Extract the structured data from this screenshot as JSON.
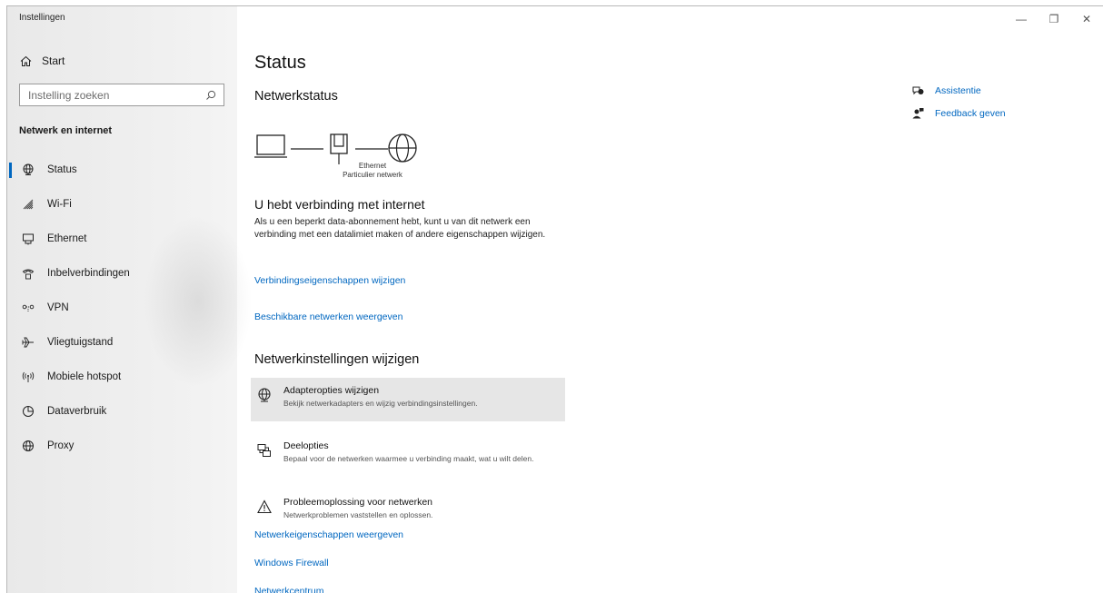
{
  "app": {
    "title": "Instellingen"
  },
  "window_controls": {
    "minimize": "—",
    "maximize": "❐",
    "close": "✕"
  },
  "sidebar": {
    "home_label": "Start",
    "search_placeholder": "Instelling zoeken",
    "section_title": "Netwerk en internet",
    "items": [
      {
        "label": "Status",
        "icon": "globe-network-icon",
        "active": true
      },
      {
        "label": "Wi-Fi",
        "icon": "wifi-icon"
      },
      {
        "label": "Ethernet",
        "icon": "ethernet-icon"
      },
      {
        "label": "Inbelverbindingen",
        "icon": "dialup-icon"
      },
      {
        "label": "VPN",
        "icon": "vpn-icon"
      },
      {
        "label": "Vliegtuigstand",
        "icon": "airplane-icon"
      },
      {
        "label": "Mobiele hotspot",
        "icon": "hotspot-icon"
      },
      {
        "label": "Dataverbruik",
        "icon": "data-usage-icon"
      },
      {
        "label": "Proxy",
        "icon": "globe-icon"
      }
    ]
  },
  "main": {
    "title": "Status",
    "network_status_heading": "Netwerkstatus",
    "adapter_name": "Ethernet",
    "network_profile": "Particulier netwerk",
    "connection_title": "U hebt verbinding met internet",
    "connection_description": "Als u een beperkt data-abonnement hebt, kunt u van dit netwerk een verbinding met een datalimiet maken of andere eigenschappen wijzigen.",
    "link_connection_properties": "Verbindingseigenschappen wijzigen",
    "link_available_networks": "Beschikbare netwerken weergeven",
    "change_settings_heading": "Netwerkinstellingen wijzigen",
    "options": [
      {
        "title": "Adapteropties wijzigen",
        "desc": "Bekijk netwerkadapters en wijzig verbindingsinstellingen.",
        "icon": "adapter-globe-icon"
      },
      {
        "title": "Deelopties",
        "desc": "Bepaal voor de netwerken waarmee u verbinding maakt, wat u wilt delen.",
        "icon": "sharing-icon"
      },
      {
        "title": "Probleemoplossing voor netwerken",
        "desc": "Netwerkproblemen vaststellen en oplossen.",
        "icon": "warning-icon"
      }
    ],
    "link_network_properties": "Netwerkeigenschappen weergeven",
    "link_firewall": "Windows Firewall",
    "link_network_center": "Netwerkcentrum"
  },
  "aside": {
    "help_label": "Assistentie",
    "feedback_label": "Feedback geven"
  },
  "colors": {
    "accent": "#0067c0",
    "sidebar_bg": "#ececec",
    "hover_bg": "#e6e6e6"
  }
}
